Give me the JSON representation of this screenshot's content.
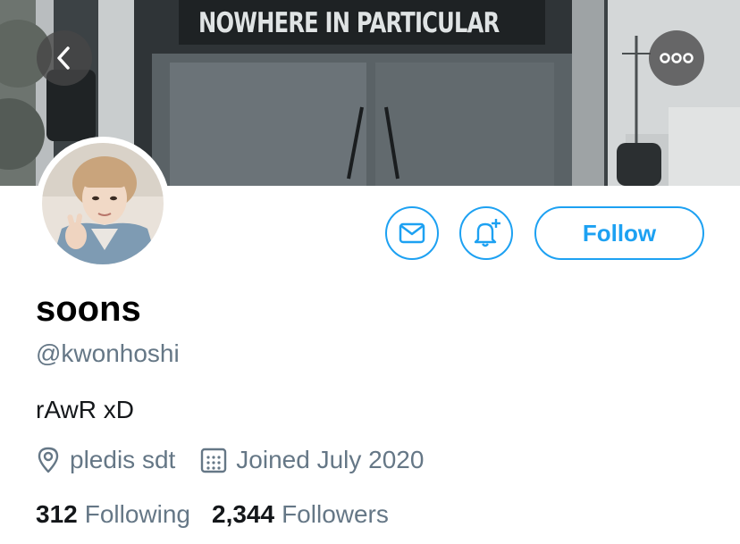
{
  "banner": {
    "sign_text": "NOWHERE IN PARTICULAR"
  },
  "nav": {
    "back_icon": "chevron-left-icon",
    "more_icon": "more-horizontal-icon"
  },
  "actions": {
    "message_icon": "envelope-icon",
    "notify_icon": "bell-plus-icon",
    "follow_label": "Follow"
  },
  "profile": {
    "display_name": "soons",
    "handle": "@kwonhoshi",
    "bio": "rAwR xD",
    "location": "pledis sdt",
    "joined": "Joined July 2020",
    "following_count": "312",
    "following_label": "Following",
    "followers_count": "2,344",
    "followers_label": "Followers"
  },
  "colors": {
    "accent": "#1da1f2",
    "secondary_text": "#657786",
    "primary_text": "#14171a"
  }
}
